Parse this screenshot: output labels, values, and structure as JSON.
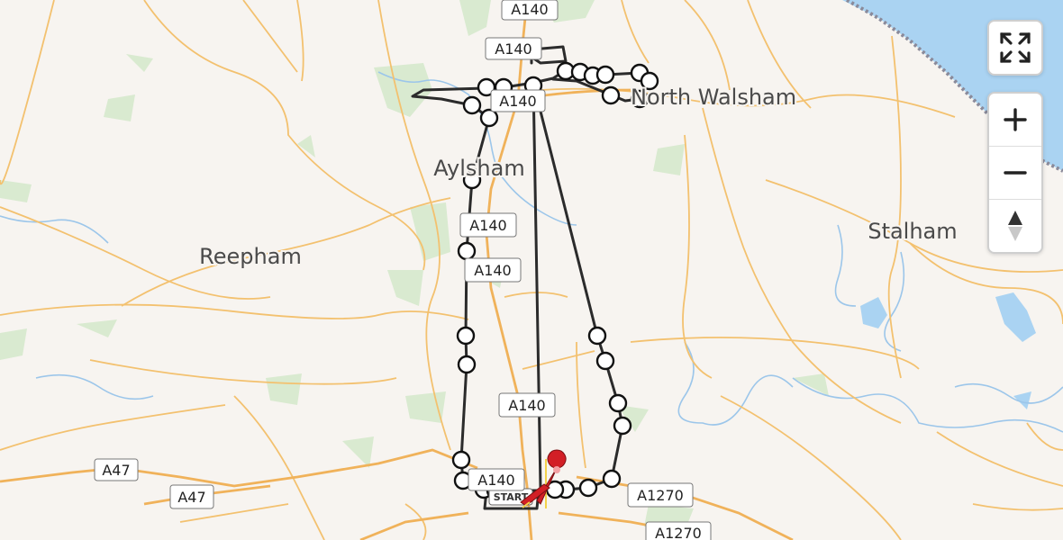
{
  "map": {
    "place_labels": [
      "North Walsham",
      "Aylsham",
      "Reepham",
      "Stalham"
    ],
    "road_shields": [
      "A140",
      "A140",
      "A140",
      "A140",
      "A140",
      "A140",
      "A140",
      "A47",
      "A47",
      "A1270",
      "A1270"
    ],
    "start_label": "START",
    "colors": {
      "land": "#f7f4f0",
      "water": "#aad3f2",
      "green": "#d9ead0",
      "roads": "#f3c16f",
      "route": "#2b2b2b",
      "marker": "#d21f26"
    }
  },
  "controls": {
    "fullscreen_icon": "fullscreen-arrows-icon",
    "zoom_in_icon": "plus-icon",
    "zoom_out_icon": "minus-icon",
    "compass_icon": "compass-arrow-icon"
  }
}
